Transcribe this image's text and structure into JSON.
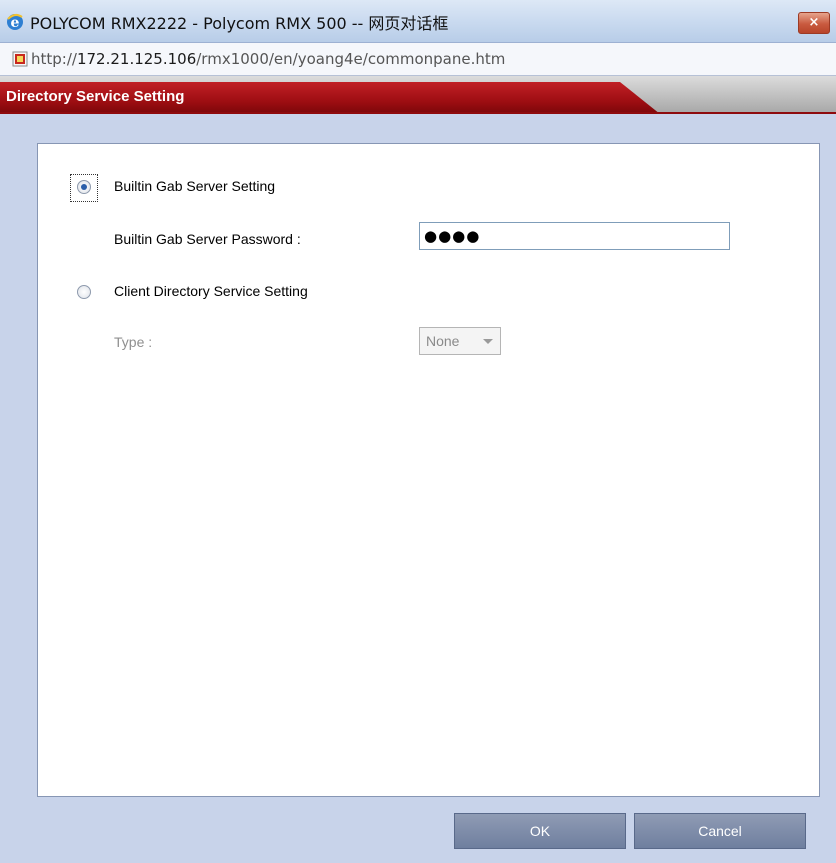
{
  "window": {
    "title": "POLYCOM RMX2222 - Polycom RMX 500 -- 网页对话框",
    "close_label": "×"
  },
  "address": {
    "prefix": "http://",
    "host": "172.21.125.106",
    "path": "/rmx1000/en/yoang4e/commonpane.htm"
  },
  "header": {
    "title": "Directory Service Setting"
  },
  "form": {
    "builtin_label": "Builtin Gab Server Setting",
    "builtin_selected": true,
    "password_label": "Builtin Gab Server Password :",
    "password_value": "●●●●",
    "client_label": "Client Directory Service Setting",
    "client_selected": false,
    "type_label": "Type :",
    "type_value": "None"
  },
  "buttons": {
    "ok": "OK",
    "cancel": "Cancel"
  },
  "colors": {
    "header_red": "#9e0e12",
    "background": "#c8d3ea",
    "button": "#7a88a6"
  }
}
